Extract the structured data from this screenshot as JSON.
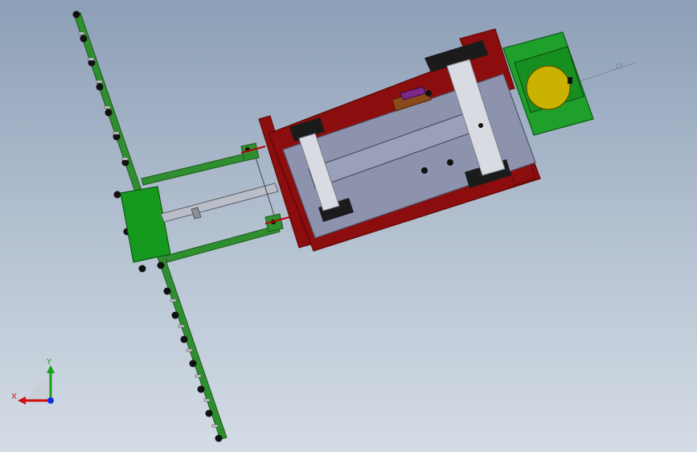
{
  "viewport": {
    "background_top": "#8d9fb7",
    "background_bottom": "#d4dce5"
  },
  "model": {
    "colors": {
      "frame": "#2f8f2f",
      "frame_dark": "#1d5a1d",
      "chassis": "#8b0d0d",
      "chassis_dark": "#5e0606",
      "deck": "#8e93ad",
      "wheel": "#1b1b1b",
      "roller": "#d8dbe2",
      "motor_housing": "#1fa02a",
      "motor_disc": "#c9b200",
      "bolt": "#111111"
    },
    "icons": [
      "wheel-icon",
      "bolt-icon",
      "motor-disc-icon"
    ]
  },
  "triad": {
    "x_label": "X",
    "y_label": "Y",
    "x_color": "#d01010",
    "y_color": "#18a018",
    "z_color": "#1030e0"
  }
}
